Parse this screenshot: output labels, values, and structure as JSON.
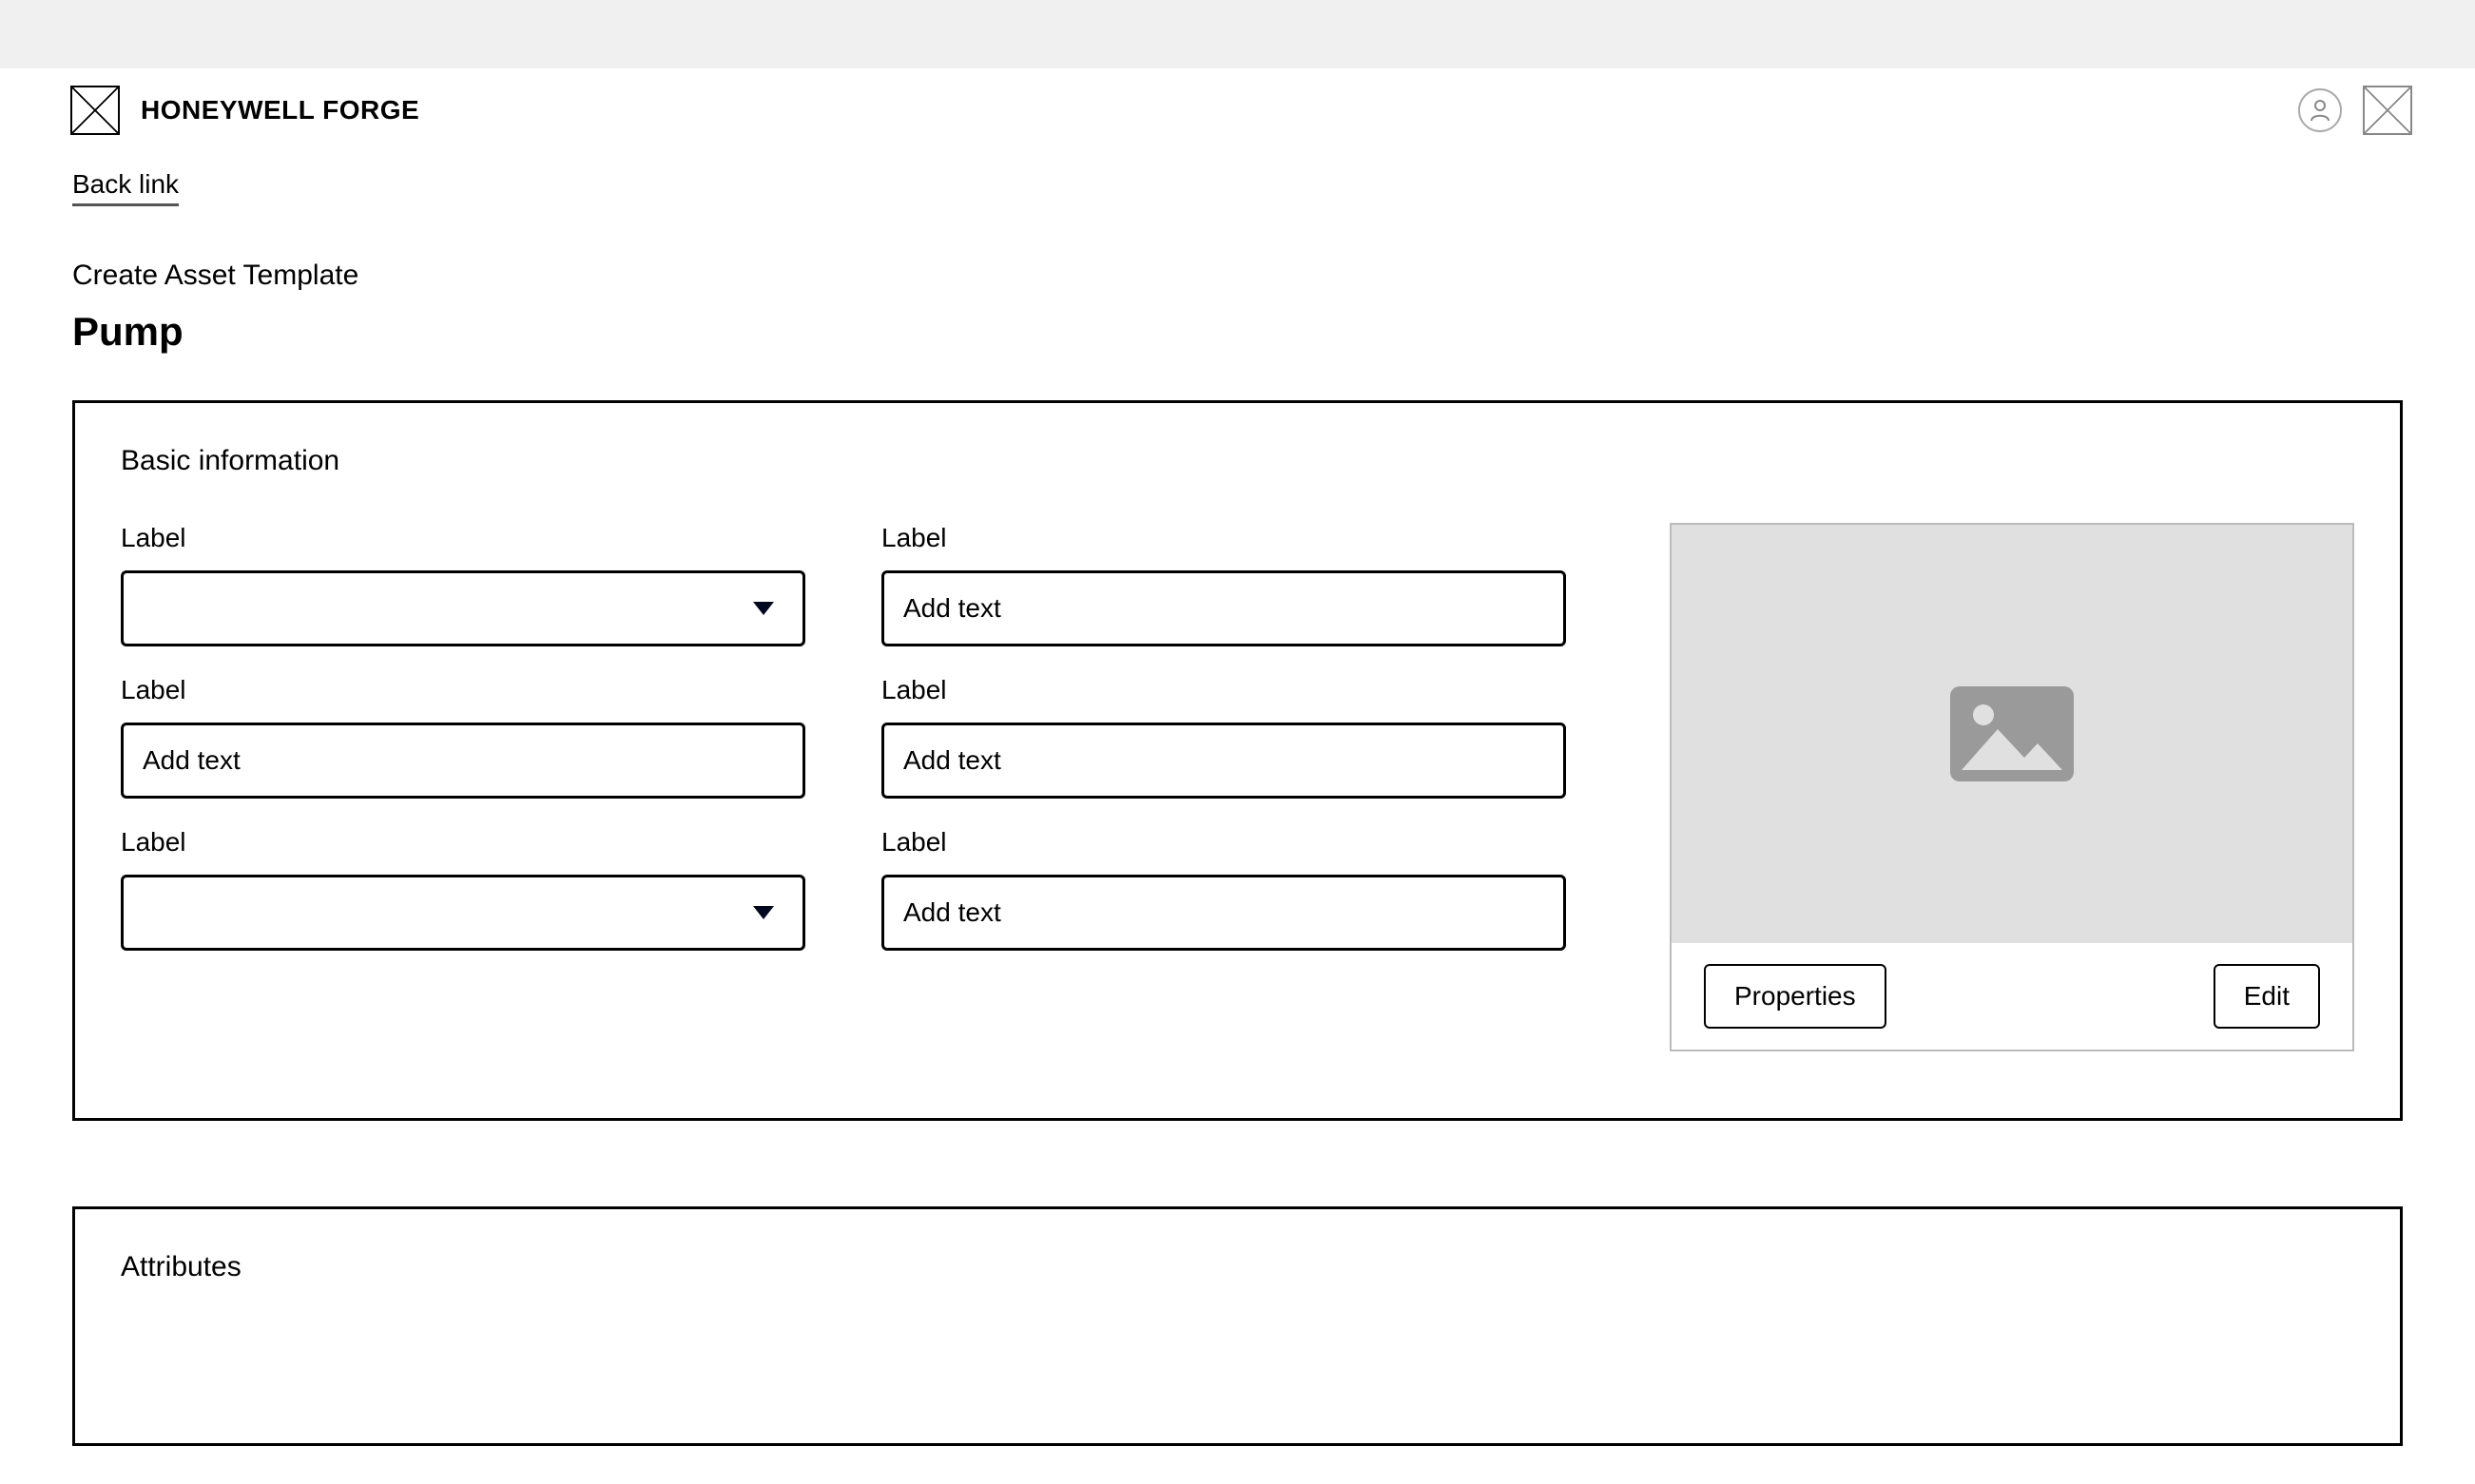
{
  "header": {
    "brand": "HONEYWELL FORGE"
  },
  "nav": {
    "back_label": "Back link"
  },
  "page": {
    "breadcrumb": "Create Asset Template",
    "title": "Pump"
  },
  "basic": {
    "section_title": "Basic information",
    "left": {
      "field1": {
        "label": "Label",
        "value": ""
      },
      "field2": {
        "label": "Label",
        "placeholder": "Add text"
      },
      "field3": {
        "label": "Label",
        "value": ""
      }
    },
    "right": {
      "field1": {
        "label": "Label",
        "placeholder": "Add text"
      },
      "field2": {
        "label": "Label",
        "placeholder": "Add text"
      },
      "field3": {
        "label": "Label",
        "placeholder": "Add text"
      }
    },
    "image": {
      "properties_label": "Properties",
      "edit_label": "Edit"
    }
  },
  "attributes": {
    "section_title": "Attributes"
  }
}
